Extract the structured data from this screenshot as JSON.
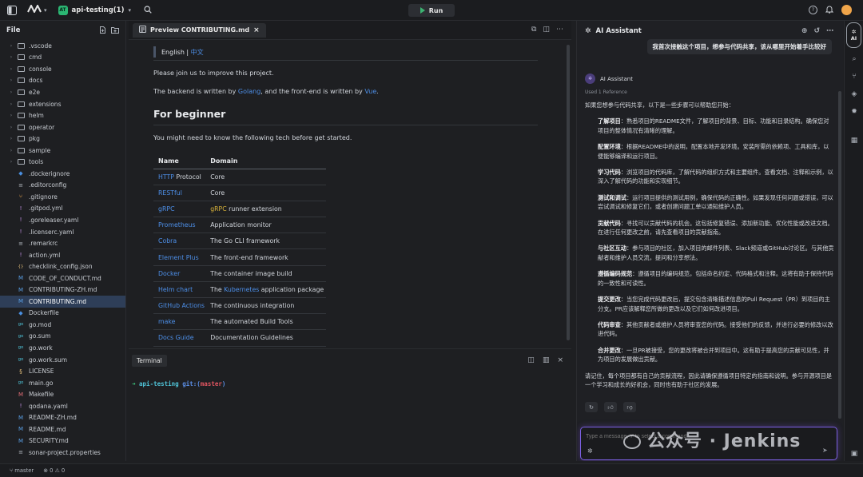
{
  "titlebar": {
    "project_badge": "AT",
    "project_name": "api-testing(1)",
    "run_label": "Run"
  },
  "explorer": {
    "title": "File",
    "items": [
      {
        "name": ".vscode",
        "type": "folder"
      },
      {
        "name": "cmd",
        "type": "folder"
      },
      {
        "name": "console",
        "type": "folder"
      },
      {
        "name": "docs",
        "type": "folder"
      },
      {
        "name": "e2e",
        "type": "folder"
      },
      {
        "name": "extensions",
        "type": "folder"
      },
      {
        "name": "helm",
        "type": "folder"
      },
      {
        "name": "operator",
        "type": "folder"
      },
      {
        "name": "pkg",
        "type": "folder"
      },
      {
        "name": "sample",
        "type": "folder"
      },
      {
        "name": "tools",
        "type": "folder"
      },
      {
        "name": ".dockerignore",
        "type": "file"
      },
      {
        "name": ".editorconfig",
        "type": "file"
      },
      {
        "name": ".gitignore",
        "type": "file"
      },
      {
        "name": ".gitpod.yml",
        "type": "file"
      },
      {
        "name": ".goreleaser.yaml",
        "type": "file"
      },
      {
        "name": ".licenserc.yaml",
        "type": "file"
      },
      {
        "name": ".remarkrc",
        "type": "file"
      },
      {
        "name": "action.yml",
        "type": "file"
      },
      {
        "name": "checklink_config.json",
        "type": "file"
      },
      {
        "name": "CODE_OF_CONDUCT.md",
        "type": "file"
      },
      {
        "name": "CONTRIBUTING-ZH.md",
        "type": "file"
      },
      {
        "name": "CONTRIBUTING.md",
        "type": "file",
        "selected": true
      },
      {
        "name": "Dockerfile",
        "type": "file"
      },
      {
        "name": "go.mod",
        "type": "file"
      },
      {
        "name": "go.sum",
        "type": "file"
      },
      {
        "name": "go.work",
        "type": "file"
      },
      {
        "name": "go.work.sum",
        "type": "file"
      },
      {
        "name": "LICENSE",
        "type": "file"
      },
      {
        "name": "main.go",
        "type": "file"
      },
      {
        "name": "Makefile",
        "type": "file"
      },
      {
        "name": "qodana.yaml",
        "type": "file"
      },
      {
        "name": "README-ZH.md",
        "type": "file"
      },
      {
        "name": "README.md",
        "type": "file"
      },
      {
        "name": "SECURITY.md",
        "type": "file"
      },
      {
        "name": "sonar-project.properties",
        "type": "file"
      }
    ]
  },
  "editor": {
    "tab_label": "Preview CONTRIBUTING.md",
    "lang_english": "English",
    "lang_sep": " | ",
    "lang_chinese": "中文",
    "intro": "Please join us to improve this project.",
    "backend_pre": "The backend is written by ",
    "backend_link": "Golang",
    "backend_mid": ", and the front-end is written by ",
    "backend_link2": "Vue",
    "backend_post": ".",
    "heading": "For beginner",
    "tech_intro": "You might need to know the following tech before get started.",
    "table_headers": [
      "Name",
      "Domain"
    ],
    "table_rows": [
      {
        "name": "HTTP",
        "domain": "Core",
        "suffix": " Protocol",
        "domain_link": "",
        "domain_post": ""
      },
      {
        "name": "RESTful",
        "domain": "Core",
        "suffix": "",
        "domain_link": "",
        "domain_post": ""
      },
      {
        "name": "gRPC",
        "domain": "",
        "suffix": "",
        "domain_link": "gRPC",
        "domain_post": " runner extension"
      },
      {
        "name": "Prometheus",
        "domain": "Application monitor",
        "suffix": "",
        "domain_link": "",
        "domain_post": ""
      },
      {
        "name": "Cobra",
        "domain": "The Go CLI framework",
        "suffix": "",
        "domain_link": "",
        "domain_post": ""
      },
      {
        "name": "Element Plus",
        "domain": "The front-end framework",
        "suffix": "",
        "domain_link": "",
        "domain_post": ""
      },
      {
        "name": "Docker",
        "domain": "The container image build",
        "suffix": "",
        "domain_link": "",
        "domain_post": ""
      },
      {
        "name": "Helm chart",
        "domain": "The ",
        "suffix": "",
        "domain_link": "Kubernetes",
        "domain_post": " application package"
      },
      {
        "name": "GitHub Actions",
        "domain": "The continuous integration",
        "suffix": "",
        "domain_link": "",
        "domain_post": ""
      },
      {
        "name": "make",
        "domain": "The automated Build Tools",
        "suffix": "",
        "domain_link": "",
        "domain_post": ""
      },
      {
        "name": "Docs Guide",
        "domain": "Documentation Guidelines",
        "suffix": "",
        "domain_link": "",
        "domain_post": ""
      }
    ]
  },
  "terminal": {
    "tab_label": "Terminal",
    "prompt_arrow": "➜",
    "prompt_dir": "api-testing",
    "prompt_git": "git:(",
    "prompt_branch": "master",
    "prompt_close": ")"
  },
  "ai": {
    "title": "AI Assistant",
    "user_message": "我首次接触这个项目，想参与代码共享，该从哪里开始着手比较好",
    "assistant_name": "AI Assistant",
    "reference": "Used 1 Reference",
    "intro": "如果您想参与代码共享，以下是一些步骤可以帮助您开始：",
    "steps": [
      {
        "title": "了解项目",
        "text": "：熟悉项目的README文件，了解项目的背景、目标、功能和目录结构。确保您对项目的整体情况有清晰的理解。"
      },
      {
        "title": "配置环境",
        "text": "：根据README中的说明，配置本地开发环境。安装所需的依赖项、工具和库，以便能够编译和运行项目。"
      },
      {
        "title": "学习代码",
        "text": "：浏览项目的代码库，了解代码的组织方式和主要组件。查看文档、注释和示例，以深入了解代码的功能和实现细节。"
      },
      {
        "title": "测试和调试",
        "text": "：运行项目提供的测试用例，确保代码的正确性。如果发现任何问题或错误，可以尝试调试和修复它们，或者创建问题工单以通知维护人员。"
      },
      {
        "title": "贡献代码",
        "text": "：寻找可以贡献代码的机会。这包括修复错误、添加新功能、优化性能或改进文档。在进行任何更改之前，请先查看项目的贡献指南。"
      },
      {
        "title": "与社区互动",
        "text": "：参与项目的社区，加入项目的邮件列表、Slack频道或GitHub讨论区。与其他贡献者和维护人员交流，提问和分享想法。"
      },
      {
        "title": "遵循编码规范",
        "text": "：遵循项目的编码规范，包括命名约定、代码格式和注释。这将有助于保持代码的一致性和可读性。"
      },
      {
        "title": "提交更改",
        "text": "：当您完成代码更改后，提交包含清晰描述信息的Pull Request（PR）到项目的主分支。PR应该解释您所做的更改以及它们如何改进项目。"
      },
      {
        "title": "代码审查",
        "text": "：其他贡献者或维护人员将审查您的代码。接受他们的反馈，并进行必要的修改以改进代码。"
      },
      {
        "title": "合并更改",
        "text": "：一旦PR被接受，您的更改将被合并到项目中。这有助于提高您的贡献可见性，并为项目的发展做出贡献。"
      }
    ],
    "outro": "请记住，每个项目都有自己的贡献流程，因此请确保遵循项目特定的指南和说明。参与开源项目是一个学习和成长的好机会，同时也有助于社区的发展。",
    "input_placeholder": "Type a message, '/' to select a command",
    "rail_label": "AI"
  },
  "watermark": "公众号 · Jenkins",
  "status": {
    "branch": "master",
    "errors": "0",
    "warnings": "0"
  }
}
